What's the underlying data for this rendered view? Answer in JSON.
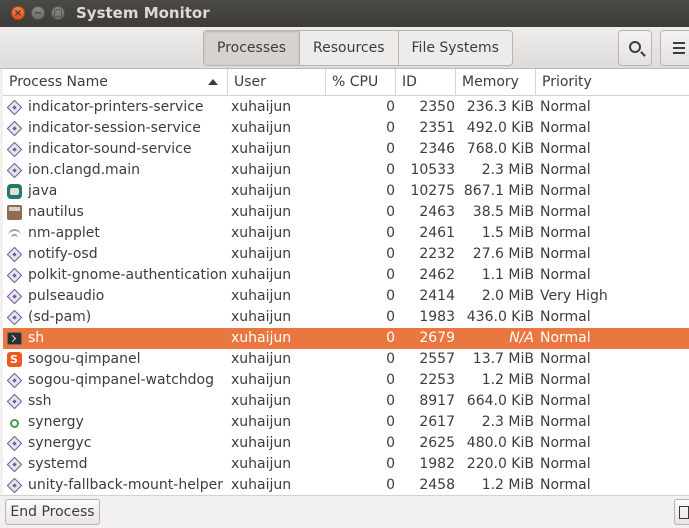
{
  "window": {
    "title": "System Monitor",
    "close_glyph": "×",
    "minimize_glyph": "−",
    "maximize_glyph": "□"
  },
  "tabs": [
    {
      "label": "Processes",
      "active": true
    },
    {
      "label": "Resources",
      "active": false
    },
    {
      "label": "File Systems",
      "active": false
    }
  ],
  "header_icons": {
    "search": "search-icon",
    "menu": "menu-icon"
  },
  "columns": {
    "name": "Process Name",
    "user": "User",
    "cpu": "% CPU",
    "id": "ID",
    "memory": "Memory",
    "priority": "Priority"
  },
  "sort": {
    "column": "name",
    "direction": "ascending"
  },
  "processes": [
    {
      "icon": "executable-icon",
      "name": "indicator-printers-service",
      "user": "xuhaijun",
      "cpu": "0",
      "id": "2350",
      "memory": "236.3 KiB",
      "priority": "Normal"
    },
    {
      "icon": "executable-icon",
      "name": "indicator-session-service",
      "user": "xuhaijun",
      "cpu": "0",
      "id": "2351",
      "memory": "492.0 KiB",
      "priority": "Normal"
    },
    {
      "icon": "executable-icon",
      "name": "indicator-sound-service",
      "user": "xuhaijun",
      "cpu": "0",
      "id": "2346",
      "memory": "768.0 KiB",
      "priority": "Normal"
    },
    {
      "icon": "executable-icon",
      "name": "ion.clangd.main",
      "user": "xuhaijun",
      "cpu": "0",
      "id": "10533",
      "memory": "2.3 MiB",
      "priority": "Normal"
    },
    {
      "icon": "java-icon",
      "name": "java",
      "user": "xuhaijun",
      "cpu": "0",
      "id": "10275",
      "memory": "867.1 MiB",
      "priority": "Normal"
    },
    {
      "icon": "nautilus-icon",
      "name": "nautilus",
      "user": "xuhaijun",
      "cpu": "0",
      "id": "2463",
      "memory": "38.5 MiB",
      "priority": "Normal"
    },
    {
      "icon": "wifi-icon",
      "name": "nm-applet",
      "user": "xuhaijun",
      "cpu": "0",
      "id": "2461",
      "memory": "1.5 MiB",
      "priority": "Normal"
    },
    {
      "icon": "executable-icon",
      "name": "notify-osd",
      "user": "xuhaijun",
      "cpu": "0",
      "id": "2232",
      "memory": "27.6 MiB",
      "priority": "Normal"
    },
    {
      "icon": "executable-icon",
      "name": "polkit-gnome-authentication-",
      "user": "xuhaijun",
      "cpu": "0",
      "id": "2462",
      "memory": "1.1 MiB",
      "priority": "Normal"
    },
    {
      "icon": "executable-icon",
      "name": "pulseaudio",
      "user": "xuhaijun",
      "cpu": "0",
      "id": "2414",
      "memory": "2.0 MiB",
      "priority": "Very High"
    },
    {
      "icon": "executable-icon",
      "name": "(sd-pam)",
      "user": "xuhaijun",
      "cpu": "0",
      "id": "1983",
      "memory": "436.0 KiB",
      "priority": "Normal"
    },
    {
      "icon": "terminal-icon",
      "name": "sh",
      "user": "xuhaijun",
      "cpu": "0",
      "id": "2679",
      "memory": "N/A",
      "priority": "Normal",
      "selected": true
    },
    {
      "icon": "sogou-icon",
      "name": "sogou-qimpanel",
      "user": "xuhaijun",
      "cpu": "0",
      "id": "2557",
      "memory": "13.7 MiB",
      "priority": "Normal"
    },
    {
      "icon": "executable-icon",
      "name": "sogou-qimpanel-watchdog",
      "user": "xuhaijun",
      "cpu": "0",
      "id": "2253",
      "memory": "1.2 MiB",
      "priority": "Normal"
    },
    {
      "icon": "executable-icon",
      "name": "ssh",
      "user": "xuhaijun",
      "cpu": "0",
      "id": "8917",
      "memory": "664.0 KiB",
      "priority": "Normal"
    },
    {
      "icon": "synergy-icon",
      "name": "synergy",
      "user": "xuhaijun",
      "cpu": "0",
      "id": "2617",
      "memory": "2.3 MiB",
      "priority": "Normal"
    },
    {
      "icon": "executable-icon",
      "name": "synergyc",
      "user": "xuhaijun",
      "cpu": "0",
      "id": "2625",
      "memory": "480.0 KiB",
      "priority": "Normal"
    },
    {
      "icon": "executable-icon",
      "name": "systemd",
      "user": "xuhaijun",
      "cpu": "0",
      "id": "1982",
      "memory": "220.0 KiB",
      "priority": "Normal"
    },
    {
      "icon": "executable-icon",
      "name": "unity-fallback-mount-helper",
      "user": "xuhaijun",
      "cpu": "0",
      "id": "2458",
      "memory": "1.2 MiB",
      "priority": "Normal"
    }
  ],
  "footer": {
    "end_process": "End Process"
  },
  "colors": {
    "selection": "#e9773f",
    "titlebar": "#3c3b37",
    "close_button": "#e0541c"
  }
}
